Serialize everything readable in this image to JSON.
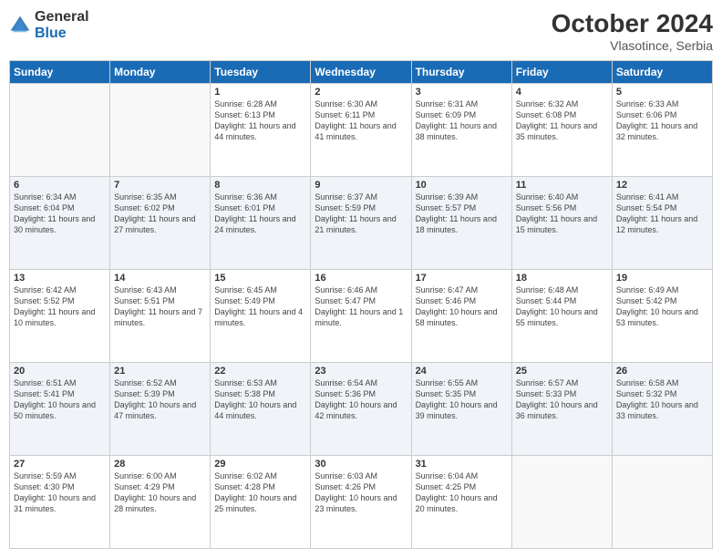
{
  "header": {
    "logo_general": "General",
    "logo_blue": "Blue",
    "month_year": "October 2024",
    "location": "Vlasotince, Serbia"
  },
  "days_of_week": [
    "Sunday",
    "Monday",
    "Tuesday",
    "Wednesday",
    "Thursday",
    "Friday",
    "Saturday"
  ],
  "weeks": [
    [
      {
        "day": "",
        "info": ""
      },
      {
        "day": "",
        "info": ""
      },
      {
        "day": "1",
        "info": "Sunrise: 6:28 AM\nSunset: 6:13 PM\nDaylight: 11 hours and 44 minutes."
      },
      {
        "day": "2",
        "info": "Sunrise: 6:30 AM\nSunset: 6:11 PM\nDaylight: 11 hours and 41 minutes."
      },
      {
        "day": "3",
        "info": "Sunrise: 6:31 AM\nSunset: 6:09 PM\nDaylight: 11 hours and 38 minutes."
      },
      {
        "day": "4",
        "info": "Sunrise: 6:32 AM\nSunset: 6:08 PM\nDaylight: 11 hours and 35 minutes."
      },
      {
        "day": "5",
        "info": "Sunrise: 6:33 AM\nSunset: 6:06 PM\nDaylight: 11 hours and 32 minutes."
      }
    ],
    [
      {
        "day": "6",
        "info": "Sunrise: 6:34 AM\nSunset: 6:04 PM\nDaylight: 11 hours and 30 minutes."
      },
      {
        "day": "7",
        "info": "Sunrise: 6:35 AM\nSunset: 6:02 PM\nDaylight: 11 hours and 27 minutes."
      },
      {
        "day": "8",
        "info": "Sunrise: 6:36 AM\nSunset: 6:01 PM\nDaylight: 11 hours and 24 minutes."
      },
      {
        "day": "9",
        "info": "Sunrise: 6:37 AM\nSunset: 5:59 PM\nDaylight: 11 hours and 21 minutes."
      },
      {
        "day": "10",
        "info": "Sunrise: 6:39 AM\nSunset: 5:57 PM\nDaylight: 11 hours and 18 minutes."
      },
      {
        "day": "11",
        "info": "Sunrise: 6:40 AM\nSunset: 5:56 PM\nDaylight: 11 hours and 15 minutes."
      },
      {
        "day": "12",
        "info": "Sunrise: 6:41 AM\nSunset: 5:54 PM\nDaylight: 11 hours and 12 minutes."
      }
    ],
    [
      {
        "day": "13",
        "info": "Sunrise: 6:42 AM\nSunset: 5:52 PM\nDaylight: 11 hours and 10 minutes."
      },
      {
        "day": "14",
        "info": "Sunrise: 6:43 AM\nSunset: 5:51 PM\nDaylight: 11 hours and 7 minutes."
      },
      {
        "day": "15",
        "info": "Sunrise: 6:45 AM\nSunset: 5:49 PM\nDaylight: 11 hours and 4 minutes."
      },
      {
        "day": "16",
        "info": "Sunrise: 6:46 AM\nSunset: 5:47 PM\nDaylight: 11 hours and 1 minute."
      },
      {
        "day": "17",
        "info": "Sunrise: 6:47 AM\nSunset: 5:46 PM\nDaylight: 10 hours and 58 minutes."
      },
      {
        "day": "18",
        "info": "Sunrise: 6:48 AM\nSunset: 5:44 PM\nDaylight: 10 hours and 55 minutes."
      },
      {
        "day": "19",
        "info": "Sunrise: 6:49 AM\nSunset: 5:42 PM\nDaylight: 10 hours and 53 minutes."
      }
    ],
    [
      {
        "day": "20",
        "info": "Sunrise: 6:51 AM\nSunset: 5:41 PM\nDaylight: 10 hours and 50 minutes."
      },
      {
        "day": "21",
        "info": "Sunrise: 6:52 AM\nSunset: 5:39 PM\nDaylight: 10 hours and 47 minutes."
      },
      {
        "day": "22",
        "info": "Sunrise: 6:53 AM\nSunset: 5:38 PM\nDaylight: 10 hours and 44 minutes."
      },
      {
        "day": "23",
        "info": "Sunrise: 6:54 AM\nSunset: 5:36 PM\nDaylight: 10 hours and 42 minutes."
      },
      {
        "day": "24",
        "info": "Sunrise: 6:55 AM\nSunset: 5:35 PM\nDaylight: 10 hours and 39 minutes."
      },
      {
        "day": "25",
        "info": "Sunrise: 6:57 AM\nSunset: 5:33 PM\nDaylight: 10 hours and 36 minutes."
      },
      {
        "day": "26",
        "info": "Sunrise: 6:58 AM\nSunset: 5:32 PM\nDaylight: 10 hours and 33 minutes."
      }
    ],
    [
      {
        "day": "27",
        "info": "Sunrise: 5:59 AM\nSunset: 4:30 PM\nDaylight: 10 hours and 31 minutes."
      },
      {
        "day": "28",
        "info": "Sunrise: 6:00 AM\nSunset: 4:29 PM\nDaylight: 10 hours and 28 minutes."
      },
      {
        "day": "29",
        "info": "Sunrise: 6:02 AM\nSunset: 4:28 PM\nDaylight: 10 hours and 25 minutes."
      },
      {
        "day": "30",
        "info": "Sunrise: 6:03 AM\nSunset: 4:26 PM\nDaylight: 10 hours and 23 minutes."
      },
      {
        "day": "31",
        "info": "Sunrise: 6:04 AM\nSunset: 4:25 PM\nDaylight: 10 hours and 20 minutes."
      },
      {
        "day": "",
        "info": ""
      },
      {
        "day": "",
        "info": ""
      }
    ]
  ]
}
